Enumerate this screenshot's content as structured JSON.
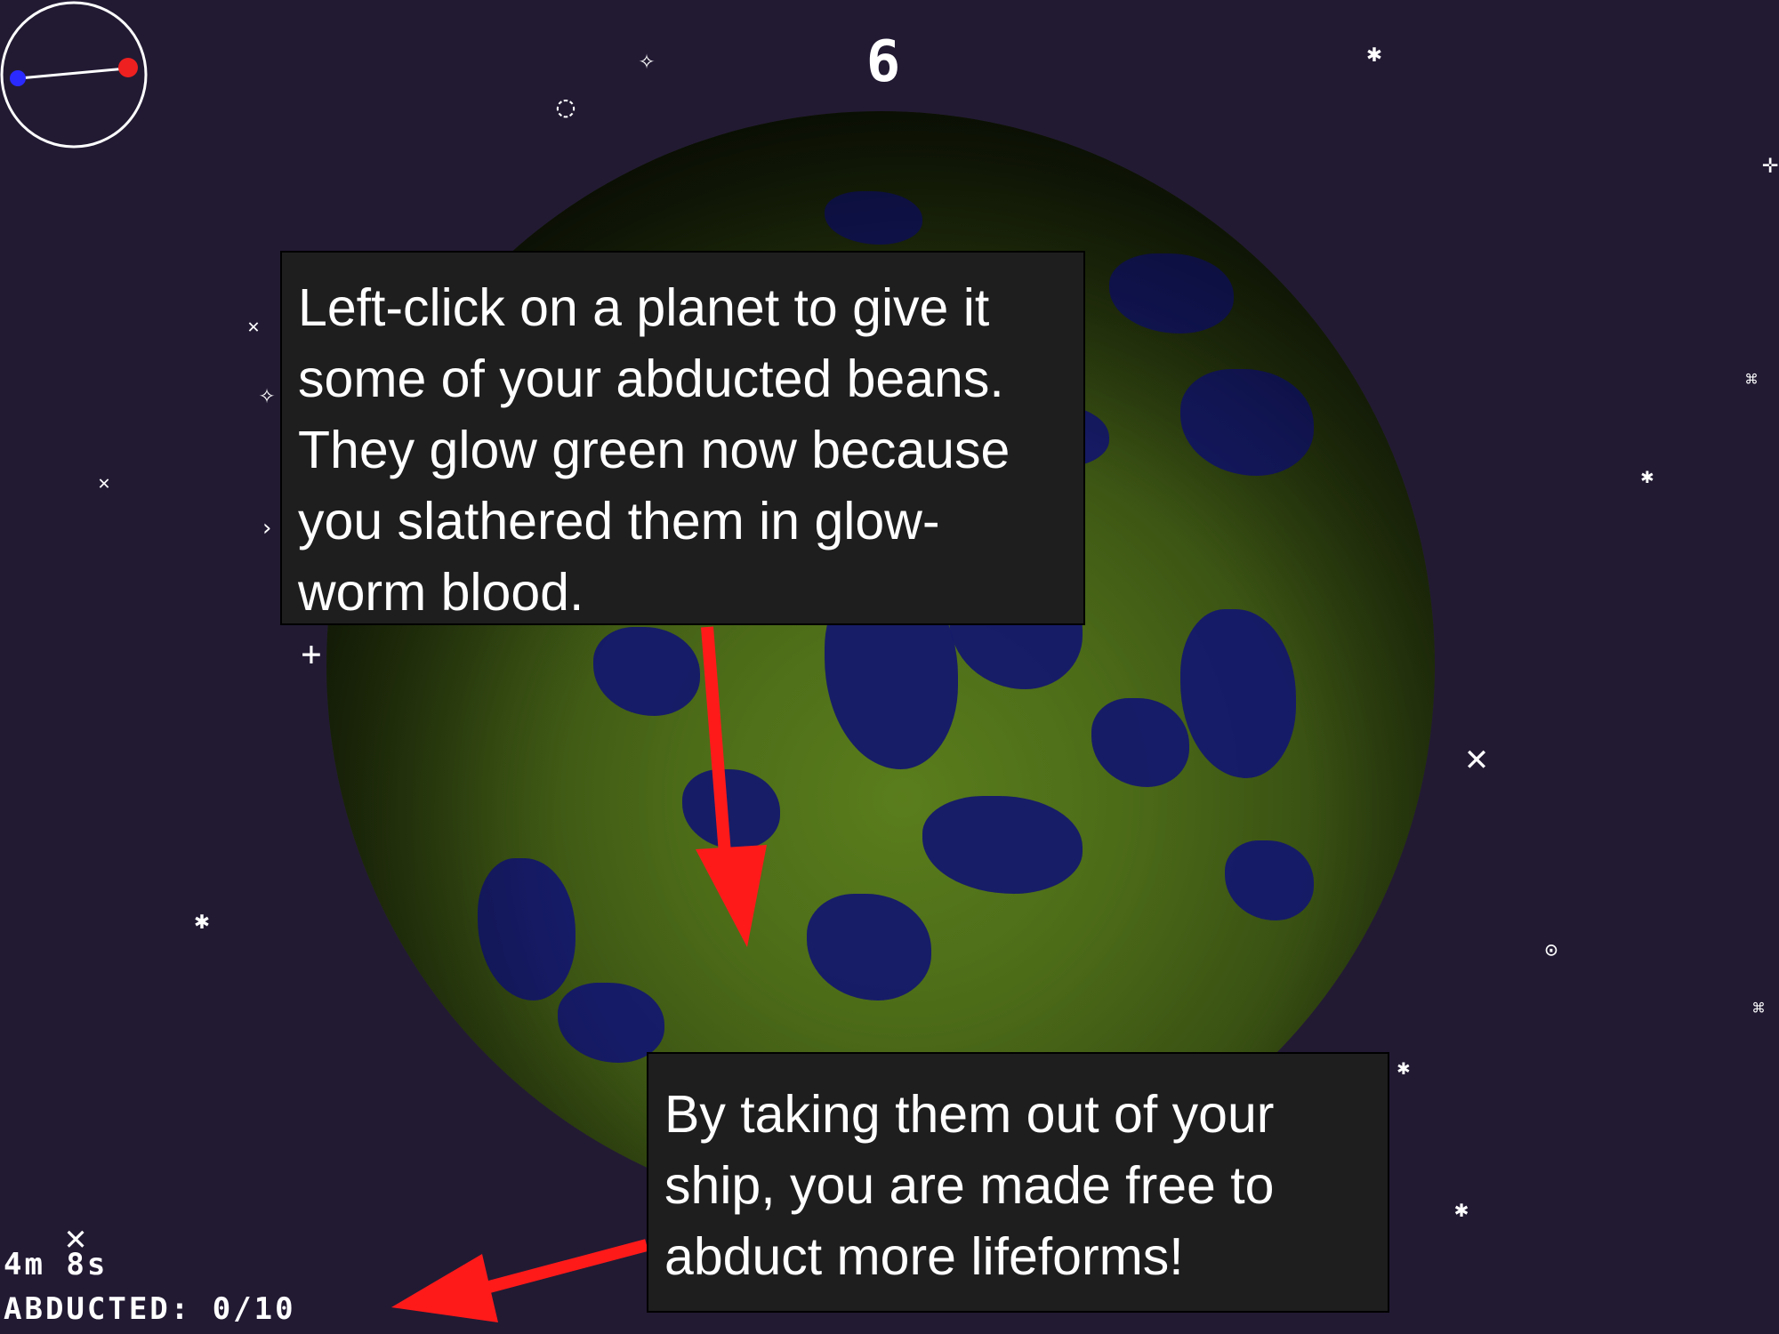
{
  "hud": {
    "score": "6",
    "timer": "4m 8s",
    "abducted": "ABDUCTED: 0/10"
  },
  "tooltips": {
    "planet_tip": "Left-click on a planet to give it some of your abducted beans. They glow green now because you slathered them in glow-worm blood.",
    "abduct_tip": "By taking them out of your ship, you are made free to abduct more lifeforms!"
  },
  "radar": {
    "icon": "radar-compass-icon",
    "markers": [
      "blue-dot",
      "red-dot"
    ]
  },
  "colors": {
    "space": "#221a33",
    "planet_land": "#5a7d1c",
    "planet_water": "#14186b",
    "arrow": "#ff1a1a",
    "tooltip_bg": "#1e1e1e",
    "text": "#ffffff"
  }
}
